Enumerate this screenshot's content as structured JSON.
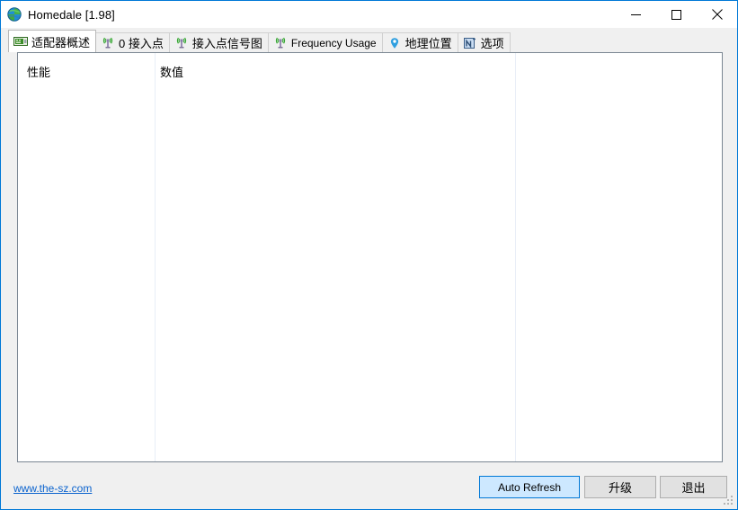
{
  "window": {
    "title": "Homedale [1.98]",
    "icon": "globe-icon",
    "accent_color": "#0078d7",
    "caption": {
      "minimize_label": "—",
      "maximize_label": "☐",
      "close_label": "✕"
    }
  },
  "tabs": [
    {
      "label": "适配器概述",
      "icon": "network-card-icon",
      "active": true,
      "cjk": true
    },
    {
      "label": "0 接入点",
      "icon": "antenna-icon",
      "active": false,
      "cjk": true
    },
    {
      "label": "接入点信号图",
      "icon": "antenna-icon",
      "active": false,
      "cjk": true
    },
    {
      "label": "Frequency Usage",
      "icon": "antenna-icon",
      "active": false,
      "cjk": false
    },
    {
      "label": "地理位置",
      "icon": "map-pin-icon",
      "active": false,
      "cjk": true
    },
    {
      "label": "选项",
      "icon": "options-icon",
      "active": false,
      "cjk": true
    }
  ],
  "listview": {
    "columns": [
      {
        "label": "性能"
      },
      {
        "label": "数值"
      }
    ],
    "rows": []
  },
  "footer": {
    "link_text": "www.the-sz.com",
    "auto_refresh_label": "Auto Refresh",
    "upgrade_label": "升级",
    "exit_label": "退出"
  }
}
